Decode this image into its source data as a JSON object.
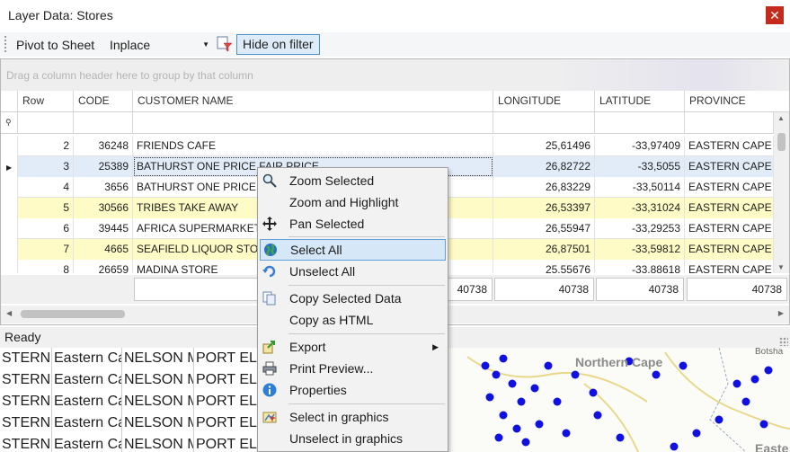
{
  "window": {
    "title": "Layer Data: Stores",
    "close_glyph": "✕"
  },
  "toolbar": {
    "pivot_label": "Pivot to Sheet",
    "inplace_value": "Inplace",
    "hide_filter_label": "Hide on filter"
  },
  "grid": {
    "group_hint": "Drag a column header here to group by that column",
    "columns": [
      "Row",
      "CODE",
      "CUSTOMER NAME",
      "LONGITUDE",
      "LATITUDE",
      "PROVINCE"
    ],
    "rows": [
      {
        "row": "2",
        "code": "36248",
        "name": "FRIENDS CAFE",
        "lon": "25,61496",
        "lat": "-33,97409",
        "prov": "EASTERN CAPE"
      },
      {
        "row": "3",
        "code": "25389",
        "name": "BATHURST ONE PRICE FAIR PRICE",
        "lon": "26,82722",
        "lat": "-33,5055",
        "prov": "EASTERN CAPE"
      },
      {
        "row": "4",
        "code": "3656",
        "name": "BATHURST ONE PRICE",
        "lon": "26,83229",
        "lat": "-33,50114",
        "prov": "EASTERN CAPE"
      },
      {
        "row": "5",
        "code": "30566",
        "name": "TRIBES TAKE AWAY",
        "lon": "26,53397",
        "lat": "-33,31024",
        "prov": "EASTERN CAPE"
      },
      {
        "row": "6",
        "code": "39445",
        "name": "AFRICA SUPERMARKET",
        "lon": "26,55947",
        "lat": "-33,29253",
        "prov": "EASTERN CAPE"
      },
      {
        "row": "7",
        "code": "4665",
        "name": "SEAFIELD LIQUOR STORE",
        "lon": "26,87501",
        "lat": "-33,59812",
        "prov": "EASTERN CAPE"
      },
      {
        "row": "8",
        "code": "26659",
        "name": "MADINA STORE",
        "lon": "25.55676",
        "lat": "-33.88618",
        "prov": "EASTERN CAPE"
      }
    ],
    "footer": {
      "name_count": "40738",
      "lon_count": "40738",
      "lat_count": "40738",
      "prov_count": "40738"
    }
  },
  "status": {
    "text": "Ready"
  },
  "context_menu": {
    "items": [
      {
        "label": "Zoom Selected",
        "icon": "zoom-icon"
      },
      {
        "label": "Zoom and Highlight",
        "icon": ""
      },
      {
        "label": "Pan Selected",
        "icon": "pan-icon"
      },
      {
        "label": "Select All",
        "icon": "globe-icon"
      },
      {
        "label": "Unselect All",
        "icon": "unselect-icon"
      },
      {
        "label": "Copy Selected Data",
        "icon": "copy-icon"
      },
      {
        "label": "Copy as HTML",
        "icon": ""
      },
      {
        "label": "Export",
        "icon": "export-icon"
      },
      {
        "label": "Print Preview...",
        "icon": "print-icon"
      },
      {
        "label": "Properties",
        "icon": "info-icon"
      },
      {
        "label": "Select in graphics",
        "icon": "select-graphics-icon"
      },
      {
        "label": "Unselect in graphics",
        "icon": ""
      }
    ],
    "active_item": "Select All"
  },
  "background": {
    "rows": [
      [
        "STERN C",
        "Eastern Ca",
        "NELSON M",
        "PORT ELI"
      ],
      [
        "STERN C",
        "Eastern Ca",
        "NELSON M",
        "PORT ELI"
      ],
      [
        "STERN C",
        "Eastern Ca",
        "NELSON M",
        "PORT ELI"
      ],
      [
        "STERN C",
        "Eastern Ca",
        "NELSON M",
        "PORT ELI"
      ],
      [
        "STERN C",
        "Eastern Ca",
        "NELSON M",
        "PORT ELI"
      ]
    ],
    "map_labels": [
      "Northern Cape",
      "Botsha",
      "Easte"
    ]
  },
  "colors": {
    "selected_row": "#e2ebf8",
    "highlight_row": "#fffbc6",
    "menu_active": "#d6e7f7",
    "close_red": "#c42b1c",
    "map_point": "#1010e0"
  }
}
